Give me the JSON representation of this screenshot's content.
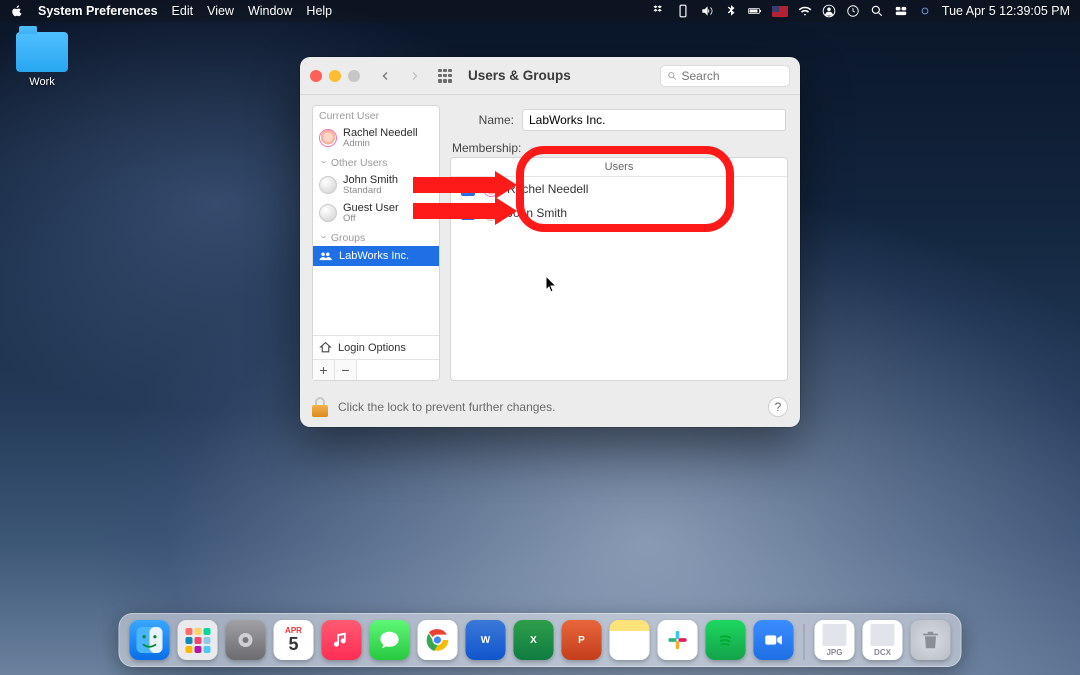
{
  "menubar": {
    "app_name": "System Preferences",
    "items": [
      "Edit",
      "View",
      "Window",
      "Help"
    ],
    "clock": "Tue Apr 5  12:39:05 PM"
  },
  "desktop": {
    "folder_label": "Work"
  },
  "window": {
    "title": "Users & Groups",
    "search_placeholder": "Search",
    "sidebar": {
      "current_user_label": "Current User",
      "current_user": {
        "name": "Rachel Needell",
        "role": "Admin"
      },
      "other_users_label": "Other Users",
      "other_users": [
        {
          "name": "John Smith",
          "role": "Standard"
        },
        {
          "name": "Guest User",
          "role": "Off"
        }
      ],
      "groups_label": "Groups",
      "groups": [
        {
          "name": "LabWorks Inc."
        }
      ],
      "login_options": "Login Options"
    },
    "main": {
      "name_label": "Name:",
      "name_value": "LabWorks Inc.",
      "membership_label": "Membership:",
      "users_header": "Users",
      "members": [
        {
          "name": "Rachel Needell",
          "checked": true
        },
        {
          "name": "John Smith",
          "checked": true
        }
      ]
    },
    "footer": {
      "lock_text": "Click the lock to prevent further changes.",
      "help": "?"
    }
  },
  "dock": {
    "calendar": {
      "month": "APR",
      "day": "5"
    },
    "doc_labels": [
      "JPG",
      "DCX"
    ],
    "apps": [
      {
        "name": "finder",
        "bg": "linear-gradient(#3aa7ff,#0a6ee8)"
      },
      {
        "name": "launchpad",
        "bg": "linear-gradient(#eee,#ddd)"
      },
      {
        "name": "settings",
        "bg": "linear-gradient(#8e8e93,#5a5a5f)"
      },
      {
        "name": "calendar",
        "bg": "#fff"
      },
      {
        "name": "music",
        "bg": "linear-gradient(#ff5b72,#ff2d55)"
      },
      {
        "name": "messages",
        "bg": "linear-gradient(#5ef777,#27c93f)"
      },
      {
        "name": "chrome",
        "bg": "#fff"
      },
      {
        "name": "word",
        "bg": "linear-gradient(#3b78d8,#1155cc)"
      },
      {
        "name": "excel",
        "bg": "linear-gradient(#2e9e4b,#107c41)"
      },
      {
        "name": "powerpoint",
        "bg": "linear-gradient(#e8663c,#c43e1c)"
      },
      {
        "name": "notes",
        "bg": "linear-gradient(#ffe27a 0 30%,#fff 30%)"
      },
      {
        "name": "slack",
        "bg": "#fff"
      },
      {
        "name": "spotify",
        "bg": "linear-gradient(#1ed760,#13a34a)"
      },
      {
        "name": "zoom",
        "bg": "linear-gradient(#3a8dff,#1f6fe5)"
      }
    ]
  }
}
